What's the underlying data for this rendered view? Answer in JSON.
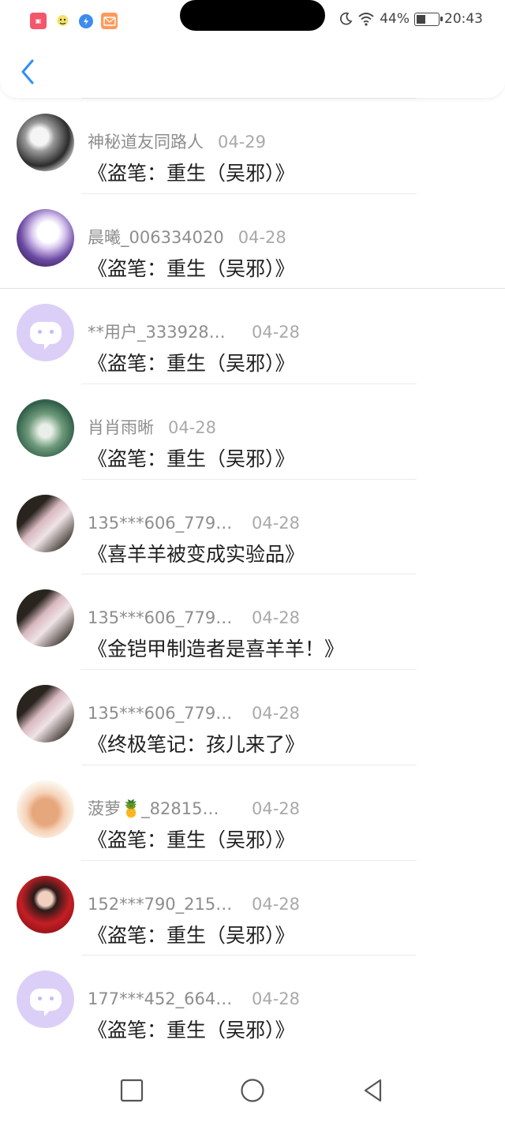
{
  "status_bar": {
    "battery_percent": "44%",
    "battery_level": 0.44,
    "time": "20:43",
    "app_icons": [
      "app-notification-red-icon",
      "cartoon-face-icon",
      "blue-bolt-icon",
      "orange-envelope-icon"
    ]
  },
  "header": {
    "back_icon": "chevron-left-icon"
  },
  "colors": {
    "accent": "#2f8ff0",
    "name_gray": "#8d8d8d",
    "date_gray": "#a9a9a9"
  },
  "items": [
    {
      "name": "神秘道友同路人",
      "date": "04-29",
      "title": "《盗笔：重生（吴邪）》",
      "avatar": "bw-portrait"
    },
    {
      "name": "晨曦_006334020",
      "date": "04-28",
      "title": "《盗笔：重生（吴邪）》",
      "avatar": "purple-anime"
    },
    {
      "name": "**用户_333928…",
      "date": "04-28",
      "title": "《盗笔：重生（吴邪）》",
      "avatar": "chat-bubble"
    },
    {
      "name": "肖肖雨晰",
      "date": "04-28",
      "title": "《盗笔：重生（吴邪）》",
      "avatar": "green-scene"
    },
    {
      "name": "135***606_779…",
      "date": "04-28",
      "title": "《喜羊羊被变成实验品》",
      "avatar": "notebook"
    },
    {
      "name": "135***606_779…",
      "date": "04-28",
      "title": "《金铠甲制造者是喜羊羊！》",
      "avatar": "notebook"
    },
    {
      "name": "135***606_779…",
      "date": "04-28",
      "title": "《终极笔记：孩儿来了》",
      "avatar": "notebook"
    },
    {
      "name": "菠萝🍍_82815…",
      "date": "04-28",
      "title": "《盗笔：重生（吴邪）》",
      "avatar": "dog"
    },
    {
      "name": "152***790_215…",
      "date": "04-28",
      "title": "《盗笔：重生（吴邪）》",
      "avatar": "red-portrait"
    },
    {
      "name": "177***452_664…",
      "date": "04-28",
      "title": "《盗笔：重生（吴邪）》",
      "avatar": "chat-bubble"
    }
  ],
  "nav": {
    "icons": [
      "square-recents-icon",
      "circle-home-icon",
      "triangle-back-icon"
    ]
  }
}
